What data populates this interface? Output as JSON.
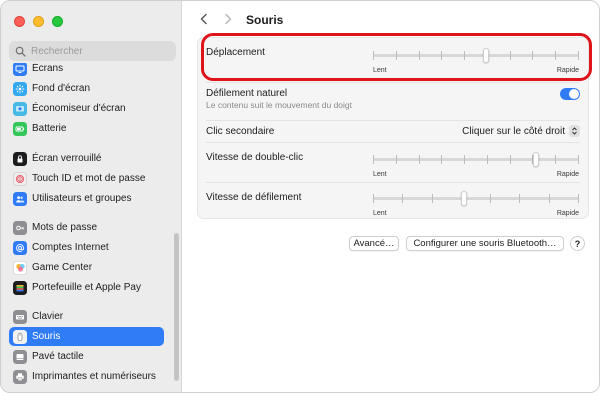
{
  "window": {
    "title": "Souris",
    "colors": {
      "accent": "#2f7cf6",
      "highlight": "#e0131a"
    }
  },
  "search": {
    "placeholder": "Rechercher"
  },
  "sidebar": {
    "items": [
      {
        "label": "Écrans",
        "icon": "display-icon",
        "color": "#2f7cf6"
      },
      {
        "label": "Fond d'écran",
        "icon": "wallpaper-icon",
        "color": "#33a7f0"
      },
      {
        "label": "Économiseur d'écran",
        "icon": "screensaver-icon",
        "color": "#48b9e5"
      },
      {
        "label": "Batterie",
        "icon": "battery-icon",
        "color": "#34c759"
      },
      {
        "label": "Écran verrouillé",
        "icon": "lock-screen-icon",
        "color": "#1d1d1f"
      },
      {
        "label": "Touch ID et mot de passe",
        "icon": "fingerprint-icon",
        "color": "#f0eded"
      },
      {
        "label": "Utilisateurs et groupes",
        "icon": "users-icon",
        "color": "#2f7cf6"
      },
      {
        "label": "Mots de passe",
        "icon": "key-icon",
        "color": "#8e8e93"
      },
      {
        "label": "Comptes Internet",
        "icon": "at-icon",
        "color": "#2f7cf6"
      },
      {
        "label": "Game Center",
        "icon": "game-center-icon",
        "color": "#ffffff"
      },
      {
        "label": "Portefeuille et Apple Pay",
        "icon": "wallet-icon",
        "color": "#1d1d1f"
      },
      {
        "label": "Clavier",
        "icon": "keyboard-icon",
        "color": "#8e8e93"
      },
      {
        "label": "Souris",
        "icon": "mouse-icon",
        "color": "#8e8e93",
        "active": true
      },
      {
        "label": "Pavé tactile",
        "icon": "trackpad-icon",
        "color": "#8e8e93"
      },
      {
        "label": "Imprimantes et numériseurs",
        "icon": "printer-icon",
        "color": "#8e8e93"
      }
    ]
  },
  "settings": {
    "tracking": {
      "label": "Déplacement",
      "min_label": "Lent",
      "max_label": "Rapide",
      "value": 0.55,
      "ticks": 10
    },
    "natural_scroll": {
      "label": "Défilement naturel",
      "description": "Le contenu suit le mouvement du doigt",
      "enabled": true
    },
    "secondary_click": {
      "label": "Clic secondaire",
      "value": "Cliquer sur le côté droit"
    },
    "double_click_speed": {
      "label": "Vitesse de double-clic",
      "min_label": "Lent",
      "max_label": "Rapide",
      "value": 0.8,
      "ticks": 10
    },
    "scroll_speed": {
      "label": "Vitesse de défilement",
      "min_label": "Lent",
      "max_label": "Rapide",
      "value": 0.44,
      "ticks": 8
    }
  },
  "footer": {
    "advanced_label": "Avancé…",
    "bluetooth_label": "Configurer une souris Bluetooth…",
    "help_label": "?"
  }
}
